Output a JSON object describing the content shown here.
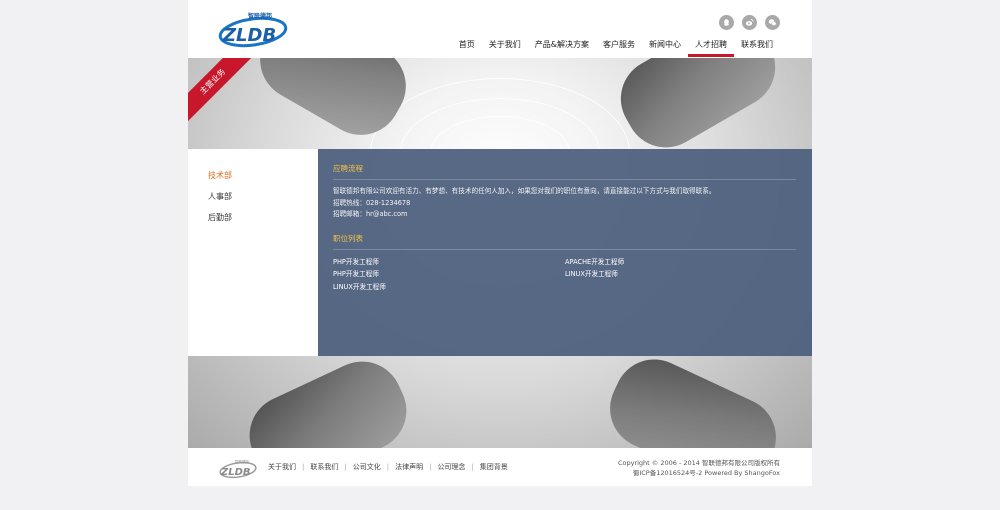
{
  "header": {
    "logo_text": "智联德邦",
    "logo_mark": "ZLDB",
    "social": [
      {
        "icon": "qq-icon"
      },
      {
        "icon": "weibo-icon"
      },
      {
        "icon": "wechat-icon"
      }
    ],
    "nav": [
      {
        "label": "首页"
      },
      {
        "label": "关于我们"
      },
      {
        "label": "产品&解决方案"
      },
      {
        "label": "客户服务"
      },
      {
        "label": "新闻中心"
      },
      {
        "label": "人才招聘",
        "active": true
      },
      {
        "label": "联系我们"
      }
    ]
  },
  "banner": {
    "ribbon": "主营业务"
  },
  "sidebar": {
    "items": [
      {
        "label": "技术部",
        "active": true
      },
      {
        "label": "人事部"
      },
      {
        "label": "后勤部"
      }
    ]
  },
  "panel": {
    "title_process": "应聘流程",
    "intro": "智联德邦有限公司欢迎有活力、有梦想、有技术的任何人加入，如果您对我们的职位有意向，请直接能过以下方式与我们取得联系。",
    "hotline": "招聘热线：028-1234678",
    "email": "招聘邮箱：hr@abc.com",
    "title_jobs": "职位列表",
    "jobs": [
      "PHP开发工程师",
      "APACHE开发工程师",
      "PHP开发工程师",
      "LINUX开发工程师",
      "LINUX开发工程师"
    ]
  },
  "footer": {
    "links": [
      "关于我们",
      "联系我们",
      "公司文化",
      "法律声明",
      "公司理念",
      "集团背景"
    ],
    "copyright_line1": "Copyright © 2006 - 2014 智联德邦有限公司版权所有",
    "copyright_line2": "蜀ICP备12016524号-2 Powered By ShangoFox"
  },
  "colors": {
    "accent": "#c8162a",
    "active_side": "#e06a1a",
    "panel_bg": "#4e607e",
    "panel_title": "#f2c244"
  }
}
